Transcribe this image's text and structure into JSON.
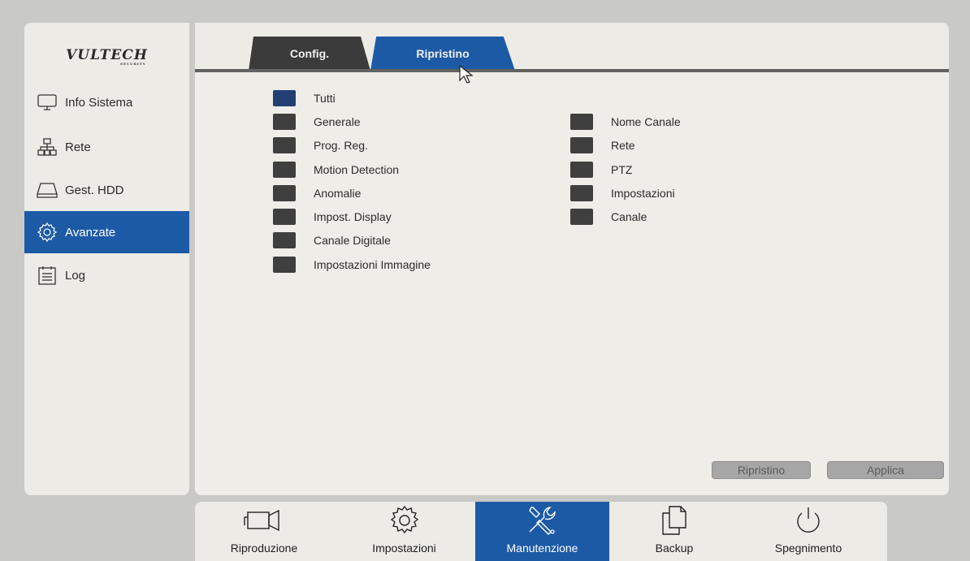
{
  "logo": {
    "text": "VULTECH",
    "subtext": "SECURITY"
  },
  "sidebar": {
    "items": [
      {
        "label": "Info Sistema",
        "icon": "monitor-icon"
      },
      {
        "label": "Rete",
        "icon": "network-icon"
      },
      {
        "label": "Gest. HDD",
        "icon": "hdd-icon"
      },
      {
        "label": "Avanzate",
        "icon": "gear-icon",
        "active": true
      },
      {
        "label": "Log",
        "icon": "log-icon"
      }
    ]
  },
  "tabs": [
    {
      "label": "Config."
    },
    {
      "label": "Ripristino",
      "active": true
    }
  ],
  "options_left": [
    {
      "label": "Tutti",
      "selected": true
    },
    {
      "label": "Generale"
    },
    {
      "label": "Prog. Reg."
    },
    {
      "label": "Motion Detection"
    },
    {
      "label": "Anomalie"
    },
    {
      "label": "Impost. Display"
    },
    {
      "label": "Canale Digitale"
    },
    {
      "label": "Impostazioni Immagine"
    }
  ],
  "options_right": [
    {
      "label": "Nome Canale"
    },
    {
      "label": "Rete"
    },
    {
      "label": "PTZ"
    },
    {
      "label": "Impostazioni"
    },
    {
      "label": "Canale"
    }
  ],
  "buttons": {
    "reset": "Ripristino",
    "apply": "Applica"
  },
  "bottombar": [
    {
      "label": "Riproduzione",
      "icon": "camera-icon"
    },
    {
      "label": "Impostazioni",
      "icon": "gear-icon"
    },
    {
      "label": "Manutenzione",
      "icon": "tools-icon",
      "active": true
    },
    {
      "label": "Backup",
      "icon": "copy-icon"
    },
    {
      "label": "Spegnimento",
      "icon": "power-icon"
    }
  ],
  "colors": {
    "accent": "#1d5aa6",
    "dark_tab": "#3b3b3b",
    "panel": "#ecebe6",
    "checkbox": "#3f3f3f"
  }
}
